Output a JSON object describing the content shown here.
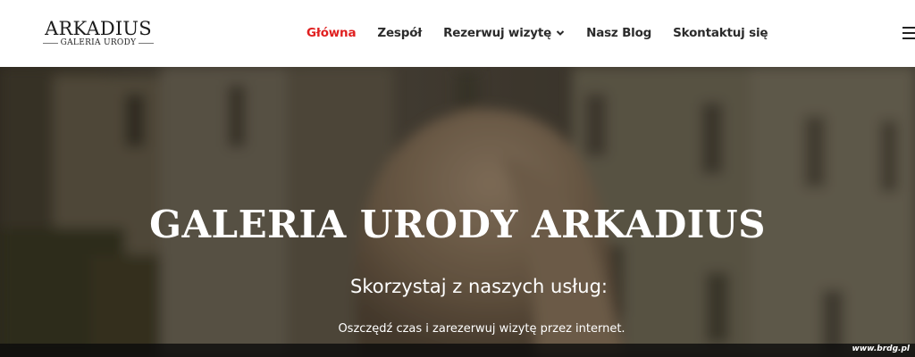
{
  "logo": {
    "title": "ARKADIUS",
    "subtitle": "GALERIA URODY"
  },
  "nav": {
    "items": [
      {
        "label": "Główna",
        "active": true
      },
      {
        "label": "Zespół"
      },
      {
        "label": "Rezerwuj wizytę",
        "has_dropdown": true
      },
      {
        "label": "Nasz Blog"
      },
      {
        "label": "Skontaktuj się"
      }
    ],
    "menu_icon": "hamburger-menu-icon",
    "active_color": "#e02020"
  },
  "hero": {
    "title": "GALERIA URODY ARKADIUS",
    "subtitle": "Skorzystaj z naszych usług:",
    "text": "Oszczędź czas i zarezerwuj wizytę przez internet."
  },
  "watermark": "www.brdg.pl"
}
